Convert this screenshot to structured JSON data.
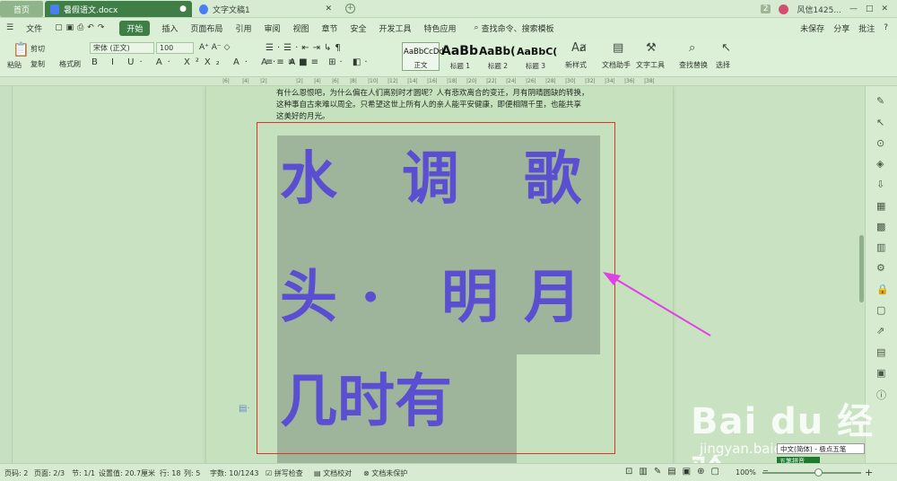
{
  "titlebar": {
    "home_tab": "首页",
    "doc_tab": "暑假语文.docx",
    "doc2_tab": "文字文稿1",
    "page_badge": "2",
    "user": "风信1425...",
    "min": "—",
    "max": "□",
    "close": "✕"
  },
  "menu": {
    "file": "文件",
    "items": [
      "开始",
      "插入",
      "页面布局",
      "引用",
      "审阅",
      "视图",
      "章节",
      "安全",
      "开发工具",
      "特色应用"
    ],
    "search": "查找命令、搜索模板",
    "unsaved": "未保存",
    "share": "分享",
    "comment": "批注"
  },
  "ribbon": {
    "cut": "剪切",
    "paste": "粘贴",
    "copy": "复制",
    "format_painter": "格式刷",
    "font_name": "宋体 (正文)",
    "font_size": "100",
    "styles": [
      {
        "preview": "AaBbCcDd",
        "label": "正文"
      },
      {
        "preview": "AaBb",
        "label": "标题 1"
      },
      {
        "preview": "AaBb(",
        "label": "标题 2"
      },
      {
        "preview": "AaBbC(",
        "label": "标题 3"
      }
    ],
    "new_style": "新样式",
    "doc_helper": "文档助手",
    "text_tools": "文字工具",
    "find_replace": "查找替换",
    "select": "选择"
  },
  "document": {
    "paragraph": [
      "有什么恩恨吧，为什么偏在人们离别时才圆呢？人有悲欢离合的变迁，月有阴晴圆缺的转换，",
      "这种事自古来难以周全。只希望这世上所有人的亲人能平安健康，即便相隔千里，也能共享",
      "这美好的月光。"
    ],
    "line1": [
      "水",
      "调",
      "歌"
    ],
    "line2": [
      "头",
      "·",
      "明",
      "月"
    ],
    "line3": "几时有"
  },
  "status": {
    "page": "页码: 2",
    "pages": "页面: 2/3",
    "section": "节: 1/1",
    "setting": "设置值: 20.7厘米",
    "row": "行: 18",
    "col": "列: 5",
    "word_count": "字数: 10/1243",
    "spell_check": "拼写检查",
    "proofread": "文档校对",
    "unprotected": "文档未保护",
    "zoom": "100%"
  },
  "overlay": {
    "watermark": "Bai du 经验",
    "watermark_url": "jingyan.baidu.com",
    "ime_text": "中文(简体) - 极点五笔",
    "ime_mode": "五笔拼音"
  },
  "colors": {
    "accent": "#3f7e46",
    "title_text": "#5a4fd0",
    "highlight": "#9fb59b",
    "frame": "#e0352b",
    "arrow": "#e040e6"
  }
}
